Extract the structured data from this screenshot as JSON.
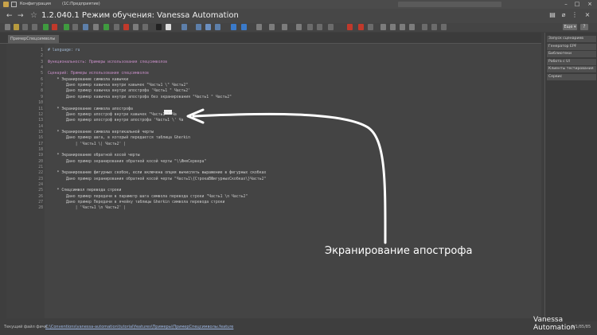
{
  "window": {
    "title_left": "Конфигурация",
    "title_right": "(1С:Предприятие)"
  },
  "header": {
    "back": "←",
    "forward": "→",
    "star": "☆",
    "title": "1.2.040.1 Режим обучения: Vanessa Automation"
  },
  "toolbar": {
    "more_label": "Еще ▾",
    "help_label": "?"
  },
  "tab": {
    "label": "ПримерСпецсимволы"
  },
  "editor": {
    "lines": [
      {
        "n": "1",
        "text": "# language: ru",
        "kind": "cm"
      },
      {
        "n": "2",
        "text": "",
        "kind": "code"
      },
      {
        "n": "3",
        "text": "Функциональность: Примеры использования спецсимволов",
        "kind": "pur"
      },
      {
        "n": "4",
        "text": "",
        "kind": "code"
      },
      {
        "n": "5",
        "text": "Сценарий: Примеры использования спецсимволов",
        "kind": "pur"
      },
      {
        "n": "6",
        "text": "    * Экранирование символа кавычки",
        "kind": "bul"
      },
      {
        "n": "7",
        "text": "        Дано пример кавычка внутри кавычек \"Часть1 \\\" Часть2\"",
        "kind": "code"
      },
      {
        "n": "8",
        "text": "        Дано пример кавычка внутри апострофа 'Часть1 \" Часть2'",
        "kind": "code"
      },
      {
        "n": "9",
        "text": "        Дано пример кавычка внутри апострофа без экранирования \"Часть1 \" Часть2\"",
        "kind": "code"
      },
      {
        "n": "10",
        "text": "",
        "kind": "code"
      },
      {
        "n": "11",
        "text": "    * Экранирование символа апострофа",
        "kind": "bul"
      },
      {
        "n": "12",
        "text": "        Дано пример апостроф внутри кавычек \"Часть1 ' Ча",
        "kind": "code"
      },
      {
        "n": "13",
        "text": "        Дано пример апостроф внутри апострофа 'Часть1 \\' Ча",
        "kind": "code"
      },
      {
        "n": "14",
        "text": "",
        "kind": "code"
      },
      {
        "n": "15",
        "text": "    * Экранирование символа вертикальной черты",
        "kind": "bul"
      },
      {
        "n": "16",
        "text": "        Дано пример шага, в который передается таблица Gherkin",
        "kind": "code"
      },
      {
        "n": "17",
        "text": "            | 'Часть1 \\| Часть2' |",
        "kind": "code"
      },
      {
        "n": "18",
        "text": "",
        "kind": "code"
      },
      {
        "n": "19",
        "text": "    * Экранирование обратной косой черты",
        "kind": "bul"
      },
      {
        "n": "20",
        "text": "        Дано пример экранирования обратной косой черты \"\\\\ИмяСервера\"",
        "kind": "code"
      },
      {
        "n": "21",
        "text": "",
        "kind": "code"
      },
      {
        "n": "22",
        "text": "    * Экранирование фигурных скобок, если включена опция вычислять выражение в фигурных скобках",
        "kind": "bul"
      },
      {
        "n": "23",
        "text": "        Дано пример экранирования обратной косой черты \"Часть1\\{СтрокаВФигурныхСкобках\\}Часть2\"",
        "kind": "code"
      },
      {
        "n": "24",
        "text": "",
        "kind": "code"
      },
      {
        "n": "25",
        "text": "    * Спецсимвол перевода строки",
        "kind": "bul"
      },
      {
        "n": "26",
        "text": "        Дано пример передачи в параметр шага символа перевода строки \"Часть1 \\n Часть2\"",
        "kind": "code"
      },
      {
        "n": "27",
        "text": "        Дано пример Передачи в ячейку таблицы Gherkin символа перевода строки",
        "kind": "code"
      },
      {
        "n": "28",
        "text": "            | 'Часть1 \\n Часть2' |",
        "kind": "code"
      }
    ]
  },
  "right_panel": {
    "items": [
      "Запуск сценариев",
      "Генератор EPF",
      "Библиотеки",
      "Работа с UI",
      "Клиенты тестирования",
      "Сервис"
    ]
  },
  "status": {
    "label": "Текущий файл фичи:",
    "path": "C:\\Conventions\\vanessa-automation\\tutorial\\features\\Примеры\\ПримерСпецсимволы.feature",
    "position": "5/1/85/85"
  },
  "annotation": {
    "text": "Экранирование апострофа"
  },
  "brand": {
    "text": "Vanessa Automation"
  },
  "colors": {
    "background": "#3e3e3e",
    "editor_bg": "#444444",
    "arrow": "#ffffff",
    "keyword_purple": "#c38cc3"
  }
}
